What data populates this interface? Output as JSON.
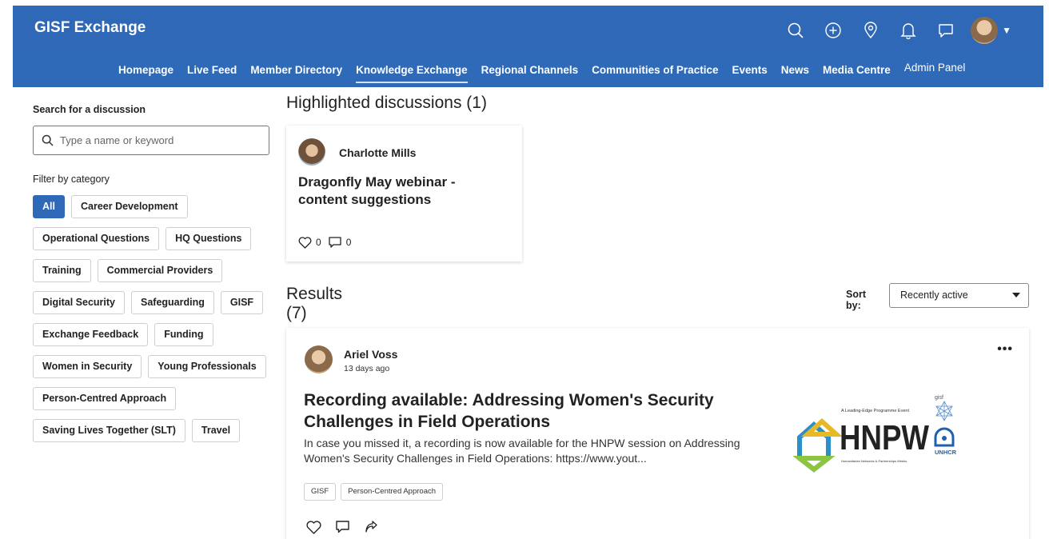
{
  "header": {
    "brand": "GISF Exchange",
    "icons": [
      "search-icon",
      "add-icon",
      "location-icon",
      "bell-icon",
      "chat-icon",
      "avatar",
      "caret-down-icon"
    ],
    "color": "#3068b8"
  },
  "nav": {
    "items": [
      "Homepage",
      "Live Feed",
      "Member Directory",
      "Knowledge Exchange",
      "Regional Channels",
      "Communities of Practice",
      "Events",
      "News",
      "Media Centre",
      "Admin Panel"
    ],
    "active": "Knowledge Exchange"
  },
  "sidebar": {
    "search_label": "Search for a discussion",
    "search_placeholder": "Type a name or keyword",
    "filter_label": "Filter by category",
    "chips": [
      {
        "label": "All",
        "active": true
      },
      {
        "label": "Career Development"
      },
      {
        "label": "Operational Questions"
      },
      {
        "label": "HQ Questions"
      },
      {
        "label": "Training"
      },
      {
        "label": "Commercial Providers"
      },
      {
        "label": "Digital Security"
      },
      {
        "label": "Safeguarding"
      },
      {
        "label": "GISF"
      },
      {
        "label": "Exchange Feedback"
      },
      {
        "label": "Funding"
      },
      {
        "label": "Women in Security"
      },
      {
        "label": "Young Professionals"
      },
      {
        "label": "Person-Centred Approach"
      },
      {
        "label": "Saving Lives Together (SLT)"
      },
      {
        "label": "Travel"
      }
    ]
  },
  "highlighted": {
    "heading": "Highlighted discussions (1)",
    "card": {
      "author": "Charlotte Mills",
      "title": "Dragonfly May webinar - content suggestions",
      "likes": "0",
      "comments": "0"
    }
  },
  "results": {
    "heading": "Results (7)",
    "sort_label": "Sort by:",
    "sort_value": "Recently active",
    "card": {
      "author": "Ariel Voss",
      "time": "13 days ago",
      "title": "Recording available: Addressing Women's Security Challenges in Field Operations",
      "excerpt": "In case you missed it, a recording is now available for the HNPW session on Addressing Women's Security Challenges in Field Operations: https://www.yout...",
      "tags": [
        "GISF",
        "Person-Centred Approach"
      ],
      "logo": {
        "event_label": "A Leading-Edge Programme Event",
        "name": "HNPW",
        "subtitle": "Humanitarian Networks & Partnerships Weeks",
        "gisf": "gisf",
        "unhcr": "UNHCR"
      }
    }
  }
}
